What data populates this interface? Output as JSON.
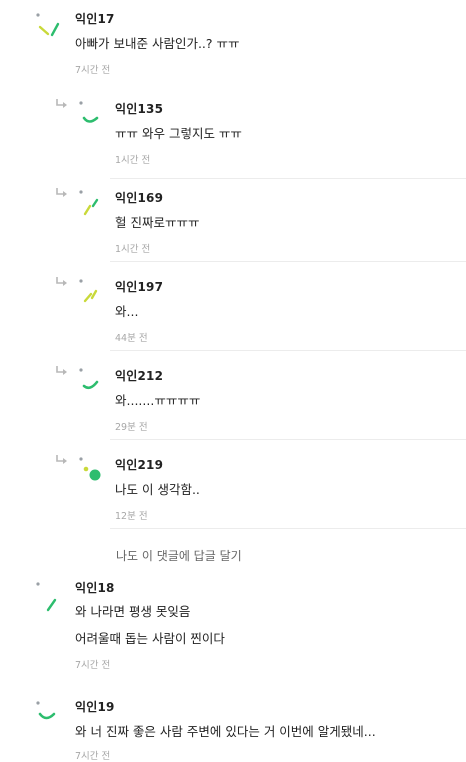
{
  "comments": [
    {
      "author": "익인17",
      "lines": [
        "아빠가 보내준 사람인가..? ㅠㅠ"
      ],
      "time": "7시간 전",
      "avatar": "yellow-green-strokes",
      "replies": [
        {
          "author": "익인135",
          "lines": [
            "ㅠㅠ 와우 그렇지도 ㅠㅠ"
          ],
          "time": "1시간 전",
          "avatar": "green-arc"
        },
        {
          "author": "익인169",
          "lines": [
            "헐 진짜로ㅠㅠㅠ"
          ],
          "time": "1시간 전",
          "avatar": "yellow-green-strokes"
        },
        {
          "author": "익인197",
          "lines": [
            "와..."
          ],
          "time": "44분 전",
          "avatar": "yellow-green-strokes"
        },
        {
          "author": "익인212",
          "lines": [
            "와.......ㅠㅠㅠㅠ"
          ],
          "time": "29분 전",
          "avatar": "green-arc"
        },
        {
          "author": "익인219",
          "lines": [
            "나도 이 생각함.."
          ],
          "time": "12분 전",
          "avatar": "green-dots"
        }
      ],
      "reply_link": "나도 이 댓글에 답글 달기"
    },
    {
      "author": "익인18",
      "lines": [
        "와 나라면 평생 못잊음",
        "어려울때 돕는 사람이 찐이다"
      ],
      "time": "7시간 전",
      "avatar": "green-stroke"
    },
    {
      "author": "익인19",
      "lines": [
        "와 너 진짜 좋은 사람 주변에 있다는 거 이번에 알게됐네..."
      ],
      "time": "7시간 전",
      "avatar": "green-arc"
    }
  ],
  "colors": {
    "accent_green": "#2dbd6e",
    "accent_yellow": "#c9d93a",
    "time_gray": "#a7a7a7",
    "divider": "#ececec"
  }
}
